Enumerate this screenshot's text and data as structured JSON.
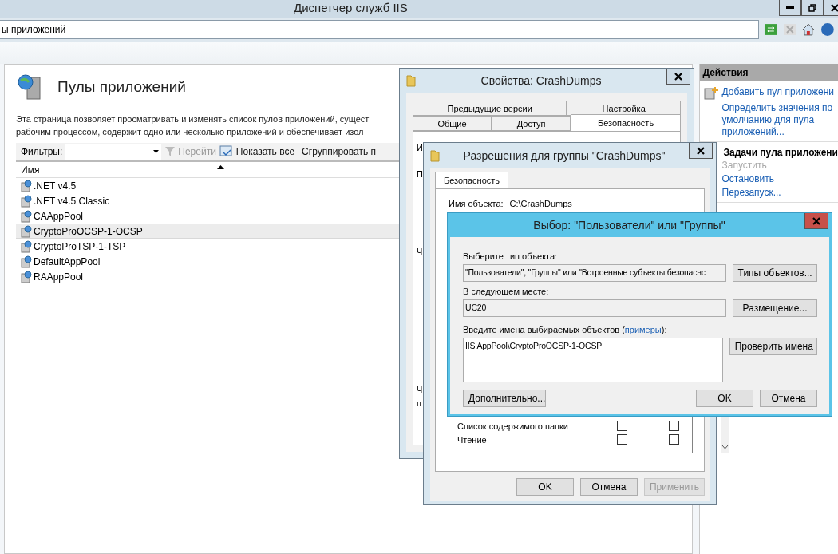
{
  "window": {
    "title": "Диспетчер служб IIS"
  },
  "address": {
    "value": "ы приложений"
  },
  "page": {
    "title": "Пулы приложений",
    "description": [
      "Эта страница позволяет просматривать и изменять список пулов приложений, сущест",
      "рабочим процессом, содержит одно или несколько приложений и обеспечивает изол"
    ]
  },
  "toolbar": {
    "filter_label": "Фильтры:",
    "go": "Перейти",
    "show_all": "Показать все",
    "group_by": "Сгруппировать п"
  },
  "table": {
    "columns": [
      "Имя"
    ],
    "rows": [
      {
        "name": ".NET v4.5",
        "selected": false
      },
      {
        "name": ".NET v4.5 Classic",
        "selected": false
      },
      {
        "name": "CAAppPool",
        "selected": false
      },
      {
        "name": "CryptoProOCSP-1-OCSP",
        "selected": true
      },
      {
        "name": "CryptoProTSP-1-TSP",
        "selected": false
      },
      {
        "name": "DefaultAppPool",
        "selected": false
      },
      {
        "name": "RAAppPool",
        "selected": false
      }
    ]
  },
  "actions": {
    "title": "Действия",
    "groups": [
      {
        "items": [
          {
            "label": "Добавить пул приложени",
            "disabled": false
          },
          {
            "label": "Определить значения по умолчанию для пула приложений...",
            "disabled": false
          }
        ]
      },
      {
        "heading": "Задачи пула приложени",
        "items": [
          {
            "label": "Запустить",
            "disabled": true
          },
          {
            "label": "Остановить",
            "disabled": false
          },
          {
            "label": "Перезапуск...",
            "disabled": false
          }
        ]
      }
    ]
  },
  "properties": {
    "title": "Свойства: CrashDumps",
    "tab_rows": [
      [
        {
          "label": "Предыдущие версии",
          "selected": false
        },
        {
          "label": "Настройка",
          "selected": false
        }
      ],
      [
        {
          "label": "Общие",
          "selected": false
        },
        {
          "label": "Доступ",
          "selected": false
        },
        {
          "label": "Безопасность",
          "selected": true
        }
      ]
    ],
    "covered_fragments": [
      "И",
      "П",
      "Ч",
      "Ч",
      "п"
    ]
  },
  "permissions": {
    "title": "Разрешения для группы \"CrashDumps\"",
    "tab": "Безопасность",
    "object_label": "Имя объекта:",
    "object_value": "C:\\CrashDumps",
    "rows": [
      {
        "name": "Список содержимого папки",
        "allow": false,
        "deny": false
      },
      {
        "name": "Чтение",
        "allow": false,
        "deny": false
      }
    ],
    "buttons": [
      {
        "label": "OK",
        "disabled": false
      },
      {
        "label": "Отмена",
        "disabled": false
      },
      {
        "label": "Применить",
        "disabled": true
      }
    ]
  },
  "select": {
    "title": "Выбор: \"Пользователи\" или \"Группы\"",
    "type_label": "Выберите тип объекта:",
    "type_value": "\"Пользователи\", \"Группы\" или \"Встроенные субъекты безопаснс",
    "type_button": "Типы объектов...",
    "location_label": "В следующем месте:",
    "location_value": "UC20",
    "location_button": "Размещение...",
    "names_label_before": "Введите имена выбираемых объектов (",
    "names_link": "примеры",
    "names_label_after": "):",
    "names_value": "IIS AppPool\\CryptoProOCSP-1-OCSP",
    "check_button": "Проверить имена",
    "buttons": [
      "Дополнительно...",
      "OK",
      "Отмена"
    ]
  }
}
